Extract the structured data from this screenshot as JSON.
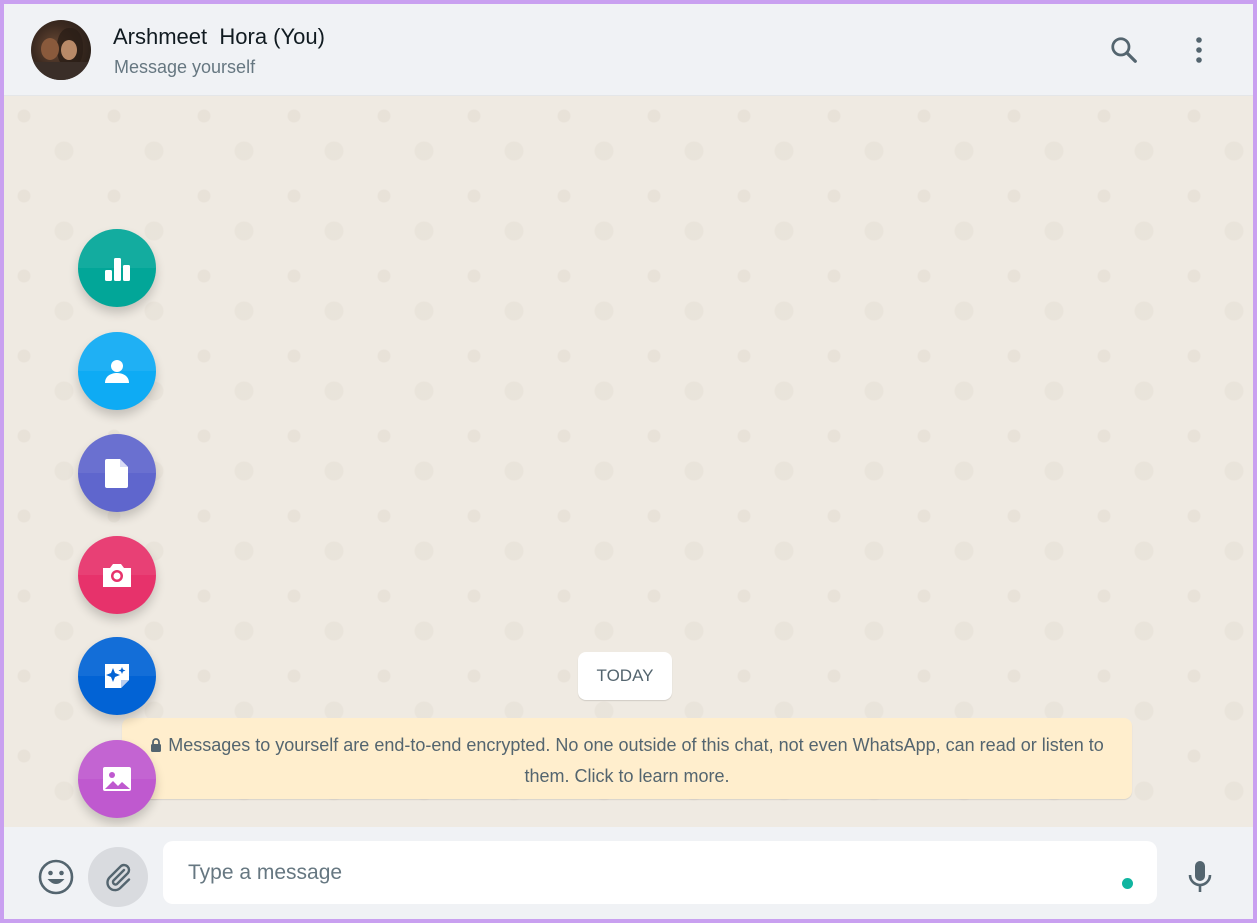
{
  "header": {
    "contact_name": "Arshmeet  Hora (You)",
    "subtitle": "Message yourself",
    "icons": {
      "search": "search-icon",
      "menu": "kebab-menu-icon"
    }
  },
  "chat": {
    "date_label": "TODAY",
    "encryption_notice": "Messages to yourself are end-to-end encrypted. No one outside of this chat, not even WhatsApp, can read or listen to them. Click to learn more."
  },
  "attachments": [
    {
      "name": "poll",
      "icon": "poll-chart-icon",
      "color": "#02a698"
    },
    {
      "name": "contact",
      "icon": "contact-person-icon",
      "color": "#0eabf4"
    },
    {
      "name": "document",
      "icon": "document-icon",
      "color": "#5f66cd"
    },
    {
      "name": "camera",
      "icon": "camera-icon",
      "color": "#e7326b"
    },
    {
      "name": "sticker",
      "icon": "sticker-icon",
      "color": "#0263d5"
    },
    {
      "name": "photos-videos",
      "icon": "image-icon",
      "color": "#bf59cf"
    }
  ],
  "composer": {
    "placeholder": "Type a message",
    "value": "",
    "icons": {
      "emoji": "emoji-icon",
      "attach": "paperclip-icon",
      "mic": "microphone-icon"
    }
  },
  "colors": {
    "accent": "#00a884",
    "header_bg": "#f0f2f5",
    "chat_bg": "#efeae2",
    "notice_bg": "#ffeecd",
    "frame": "#c9a0f0"
  }
}
